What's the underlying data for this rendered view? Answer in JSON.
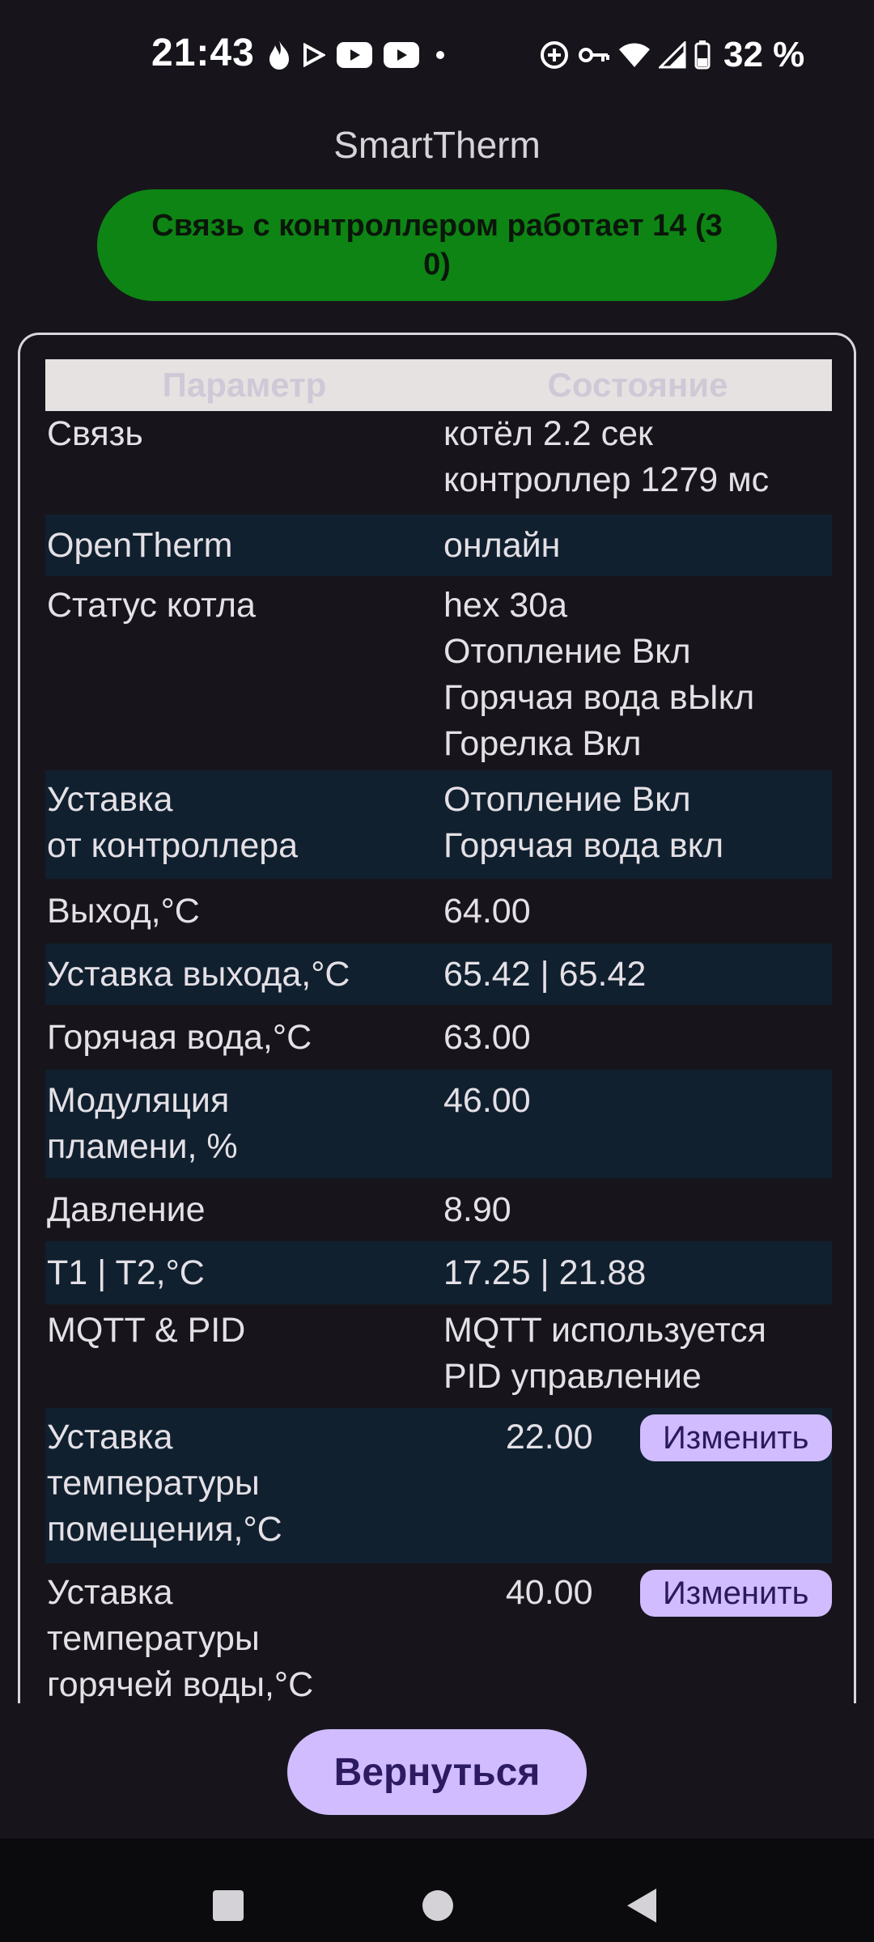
{
  "status_bar": {
    "time": "21:43",
    "battery_text": "32 %",
    "icons_left": [
      "flame-icon",
      "play-store-icon",
      "youtube-icon",
      "youtube-icon",
      "dot-icon"
    ],
    "icons_right": [
      "data-saver-icon",
      "vpn-key-icon",
      "wifi-icon",
      "signal-icon",
      "battery-icon"
    ]
  },
  "app": {
    "title": "SmartTherm",
    "banner": "Связь с контроллером работает 14 (3 0)",
    "banner_color": "#0e8414"
  },
  "table": {
    "header": {
      "param": "Параметр",
      "state": "Состояние"
    },
    "rows": [
      {
        "param": "Связь",
        "value": "котёл 2.2 сек\nконтроллер 1279 мс"
      },
      {
        "param": "OpenTherm",
        "value": "онлайн"
      },
      {
        "param": "Статус котла",
        "value": "hex 30a\nОтопление Вкл\nГорячая вода вЫкл\nГорелка Вкл"
      },
      {
        "param": "Уставка\nот контроллера",
        "value": "Отопление Вкл\nГорячая вода вкл"
      },
      {
        "param": "Выход,°C",
        "value": "64.00"
      },
      {
        "param": "Уставка выхода,°C",
        "value": "65.42 | 65.42"
      },
      {
        "param": "Горячая вода,°C",
        "value": "63.00"
      },
      {
        "param": "Модуляция\nпламени, %",
        "value": "46.00"
      },
      {
        "param": "Давление",
        "value": "8.90"
      },
      {
        "param": "T1 | T2,°C",
        "value": "17.25 | 21.88"
      },
      {
        "param": "MQTT & PID",
        "value": "MQTT используется\nPID управление"
      },
      {
        "param": "Уставка\nтемпературы\nпомещения,°C",
        "value": "22.00",
        "button": "Изменить"
      },
      {
        "param": "Уставка\nтемпературы\nгорячей воды,°C",
        "value": "40.00",
        "button": "Изменить"
      }
    ]
  },
  "footer": {
    "return_label": "Вернуться"
  },
  "colors": {
    "accent": "#d0bcfe",
    "background": "#17151b",
    "row_alt": "#10202f"
  }
}
